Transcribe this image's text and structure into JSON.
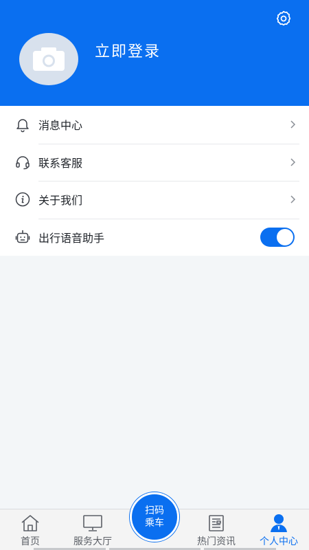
{
  "header": {
    "login_label": "立即登录",
    "background_color": "#0a6ff0",
    "avatar_icon": "camera-icon",
    "settings_icon": "gear-icon"
  },
  "menu": {
    "items": [
      {
        "label": "消息中心",
        "icon": "bell-icon",
        "trailing": "chevron"
      },
      {
        "label": "联系客服",
        "icon": "headset-icon",
        "trailing": "chevron"
      },
      {
        "label": "关于我们",
        "icon": "info-icon",
        "trailing": "chevron"
      },
      {
        "label": "出行语音助手",
        "icon": "robot-icon",
        "trailing": "toggle",
        "toggle_on": true
      }
    ]
  },
  "tabbar": {
    "tabs": [
      {
        "label": "首页",
        "icon": "home-icon",
        "active": false
      },
      {
        "label": "服务大厅",
        "icon": "monitor-icon",
        "active": false
      },
      {
        "label": "热门资讯",
        "icon": "news-icon",
        "active": false
      },
      {
        "label": "个人中心",
        "icon": "person-icon",
        "active": true
      }
    ],
    "scan": {
      "line1": "扫码",
      "line2": "乘车"
    },
    "active_color": "#0a6ff0"
  }
}
